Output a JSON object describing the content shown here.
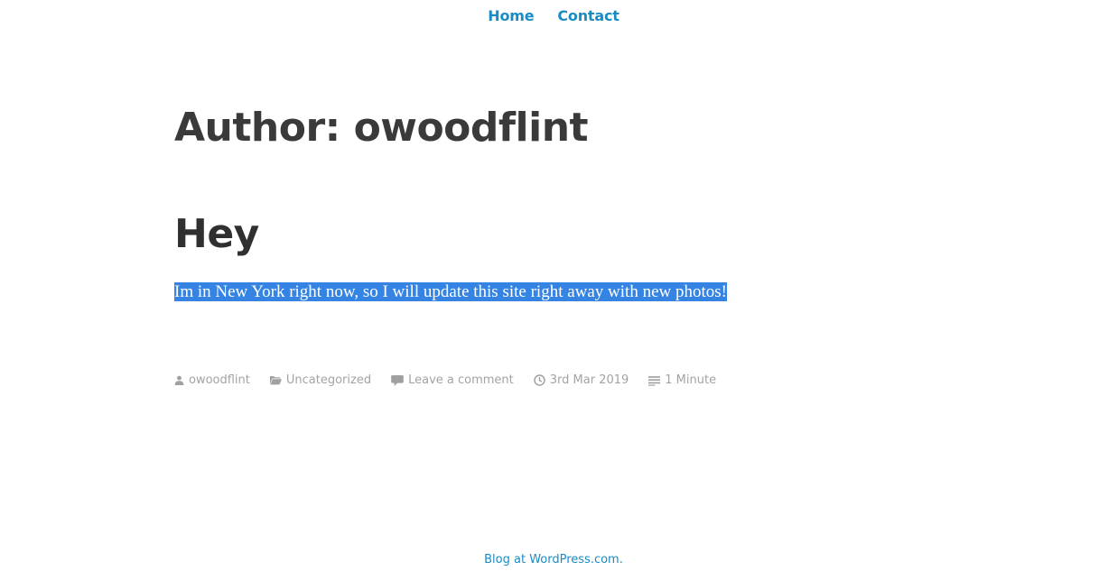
{
  "nav": {
    "items": [
      {
        "label": "Home"
      },
      {
        "label": "Contact"
      }
    ]
  },
  "archive": {
    "title": "Author: owoodflint"
  },
  "post": {
    "title": "Hey",
    "excerpt": "Im in New York right now, so I will update this site right away with new photos!",
    "meta": {
      "author": "owoodflint",
      "category": "Uncategorized",
      "comments": "Leave a comment",
      "date": "3rd Mar 2019",
      "reading_time": "1 Minute"
    }
  },
  "footer": {
    "credit": "Blog at WordPress.com."
  },
  "colors": {
    "link": "#1a8cc4",
    "heading": "#3b3a3a",
    "meta": "#a3a3a3",
    "selection": "#3584e4"
  },
  "icons": [
    "person-icon",
    "folder-icon",
    "comment-icon",
    "clock-icon",
    "reading-time-icon"
  ]
}
